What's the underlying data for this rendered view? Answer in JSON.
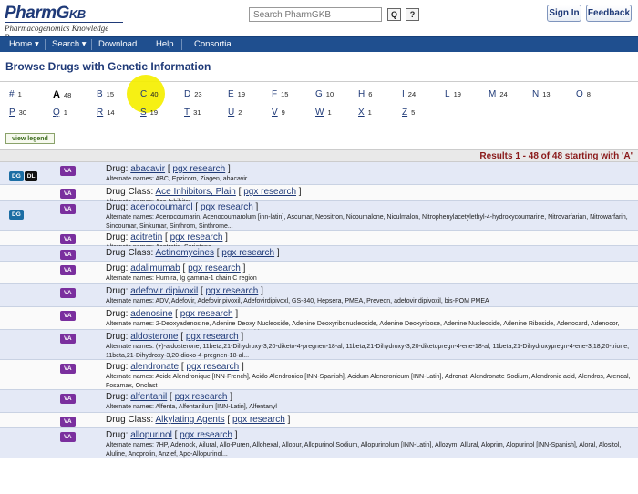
{
  "header": {
    "logo_main": "PharmG",
    "logo_kb": "KB",
    "logo_sub": "Pharmacogenomics Knowledge Base",
    "search_placeholder": "Search PharmGKB",
    "search_icon_label": "Q",
    "help_icon_label": "?",
    "signin_label": "Sign In",
    "feedback_label": "Feedback"
  },
  "nav": {
    "home": "Home ▾",
    "search": "Search ▾",
    "download": "Download",
    "help": "Help",
    "consortia": "Consortia"
  },
  "page_title": "Browse Drugs with Genetic Information",
  "letters_row1": [
    {
      "ch": "#",
      "ct": "1"
    },
    {
      "ch": "A",
      "ct": "48"
    },
    {
      "ch": "B",
      "ct": "15"
    },
    {
      "ch": "C",
      "ct": "40"
    },
    {
      "ch": "D",
      "ct": "23"
    },
    {
      "ch": "E",
      "ct": "19"
    },
    {
      "ch": "F",
      "ct": "15"
    },
    {
      "ch": "G",
      "ct": "10"
    },
    {
      "ch": "H",
      "ct": "6"
    },
    {
      "ch": "I",
      "ct": "24"
    },
    {
      "ch": "L",
      "ct": "19"
    },
    {
      "ch": "M",
      "ct": "24"
    },
    {
      "ch": "N",
      "ct": "13"
    },
    {
      "ch": "O",
      "ct": "8"
    }
  ],
  "letters_row2": [
    {
      "ch": "P",
      "ct": "30"
    },
    {
      "ch": "Q",
      "ct": "1"
    },
    {
      "ch": "R",
      "ct": "14"
    },
    {
      "ch": "S",
      "ct": "19"
    },
    {
      "ch": "T",
      "ct": "31"
    },
    {
      "ch": "U",
      "ct": "2"
    },
    {
      "ch": "V",
      "ct": "9"
    },
    {
      "ch": "W",
      "ct": "1"
    },
    {
      "ch": "X",
      "ct": "1"
    },
    {
      "ch": "Z",
      "ct": "5"
    }
  ],
  "view_legend": "view legend",
  "results_text": "Results 1 - 48 of 48 starting with 'A'",
  "rows": [
    {
      "prefix": "Drug:",
      "name": "abacavir",
      "pgx": "pgx research",
      "alt": "Alternate names: ABC, Epzicom, Ziagen, abacavir",
      "badges": [
        "DG",
        "DL"
      ]
    },
    {
      "prefix": "Drug Class:",
      "name": "Ace Inhibitors, Plain",
      "pgx": "pgx research",
      "alt": "Alternate names: Ace Inhibitor",
      "badges": []
    },
    {
      "prefix": "Drug:",
      "name": "acenocoumarol",
      "pgx": "pgx research",
      "alt": "Alternate names: Acenocoumarin, Acenocoumarolum [inn-latin], Ascumar, Neositron, Nicoumalone, Niculmalon, Nitrophenylacetylethyl-4-hydroxycoumarine, Nitrovarfarian, Nitrowarfarin, Sincoumar, Sinkumar, Sinthrom, Sinthrome...",
      "badges": [
        "DG"
      ]
    },
    {
      "prefix": "Drug:",
      "name": "acitretin",
      "pgx": "pgx research",
      "alt": "Alternate names: Acetretin, Soriatane",
      "badges": []
    },
    {
      "prefix": "Drug Class:",
      "name": "Actinomycines",
      "pgx": "pgx research",
      "alt": "",
      "badges": []
    },
    {
      "prefix": "Drug:",
      "name": "adalimumab",
      "pgx": "pgx research",
      "alt": "Alternate names: Humira, Ig gamma-1 chain C region",
      "badges": []
    },
    {
      "prefix": "Drug:",
      "name": "adefovir dipivoxil",
      "pgx": "pgx research",
      "alt": "Alternate names: ADV, Adefovir, Adefovir pivoxil, Adefovirdipivoxl, GS-840, Hepsera, PMEA, Preveon, adefovir dipivoxil, bis-POM PMEA",
      "badges": []
    },
    {
      "prefix": "Drug:",
      "name": "adenosine",
      "pgx": "pgx research",
      "alt": "Alternate names: 2-Deoxyadenosine, Adenine Deoxy Nucleoside, Adenine Deoxyribonucleoside, Adenine Deoxyribose, Adenine Nucleoside, Adenine Riboside, Adenocard, Adenocor, Adenoscan, Adenosin, Adenosine, Adenyldeoxyriboside...",
      "badges": []
    },
    {
      "prefix": "Drug:",
      "name": "aldosterone",
      "pgx": "pgx research",
      "alt": "Alternate names: (+)-aldosterone, 11beta,21-Dihydroxy-3,20-diketo-4-pregnen-18-al, 11beta,21-Dihydroxy-3,20-diketopregn-4-ene-18-al, 11beta,21-Dihydroxypregn-4-ene-3,18,20-trione, 11beta,21-Dihydroxy-3,20-dioxo-4-pregnen-18-al...",
      "badges": []
    },
    {
      "prefix": "Drug:",
      "name": "alendronate",
      "pgx": "pgx research",
      "alt": "Alternate names: Acide Alendronique [INN-French], Acido Alendronico [INN-Spanish], Acidum Alendronicum [INN-Latin], Adronat, Alendronate Sodium, Alendronic acid, Alendros, Arendal, Fosamax, Onclast",
      "badges": []
    },
    {
      "prefix": "Drug:",
      "name": "alfentanil",
      "pgx": "pgx research",
      "alt": "Alternate names: Alfenta, Alfentanilum [INN-Latin], Alfentanyl",
      "badges": []
    },
    {
      "prefix": "Drug Class:",
      "name": "Alkylating Agents",
      "pgx": "pgx research",
      "alt": "",
      "badges": []
    },
    {
      "prefix": "Drug:",
      "name": "allopurinol",
      "pgx": "pgx research",
      "alt": "Alternate names: 7HP, Adenock, Ailural, Allo-Puren, Allohexal, Allopur, Allopurinol Sodium, Allopurinolum [INN-Latin], Allozym, Allural, Aloprim, Alopurinol [INN-Spanish], Aloral, Alositol, Aluline, Anoprolin, Anzief, Apo-Allopurinol...",
      "badges": []
    }
  ]
}
